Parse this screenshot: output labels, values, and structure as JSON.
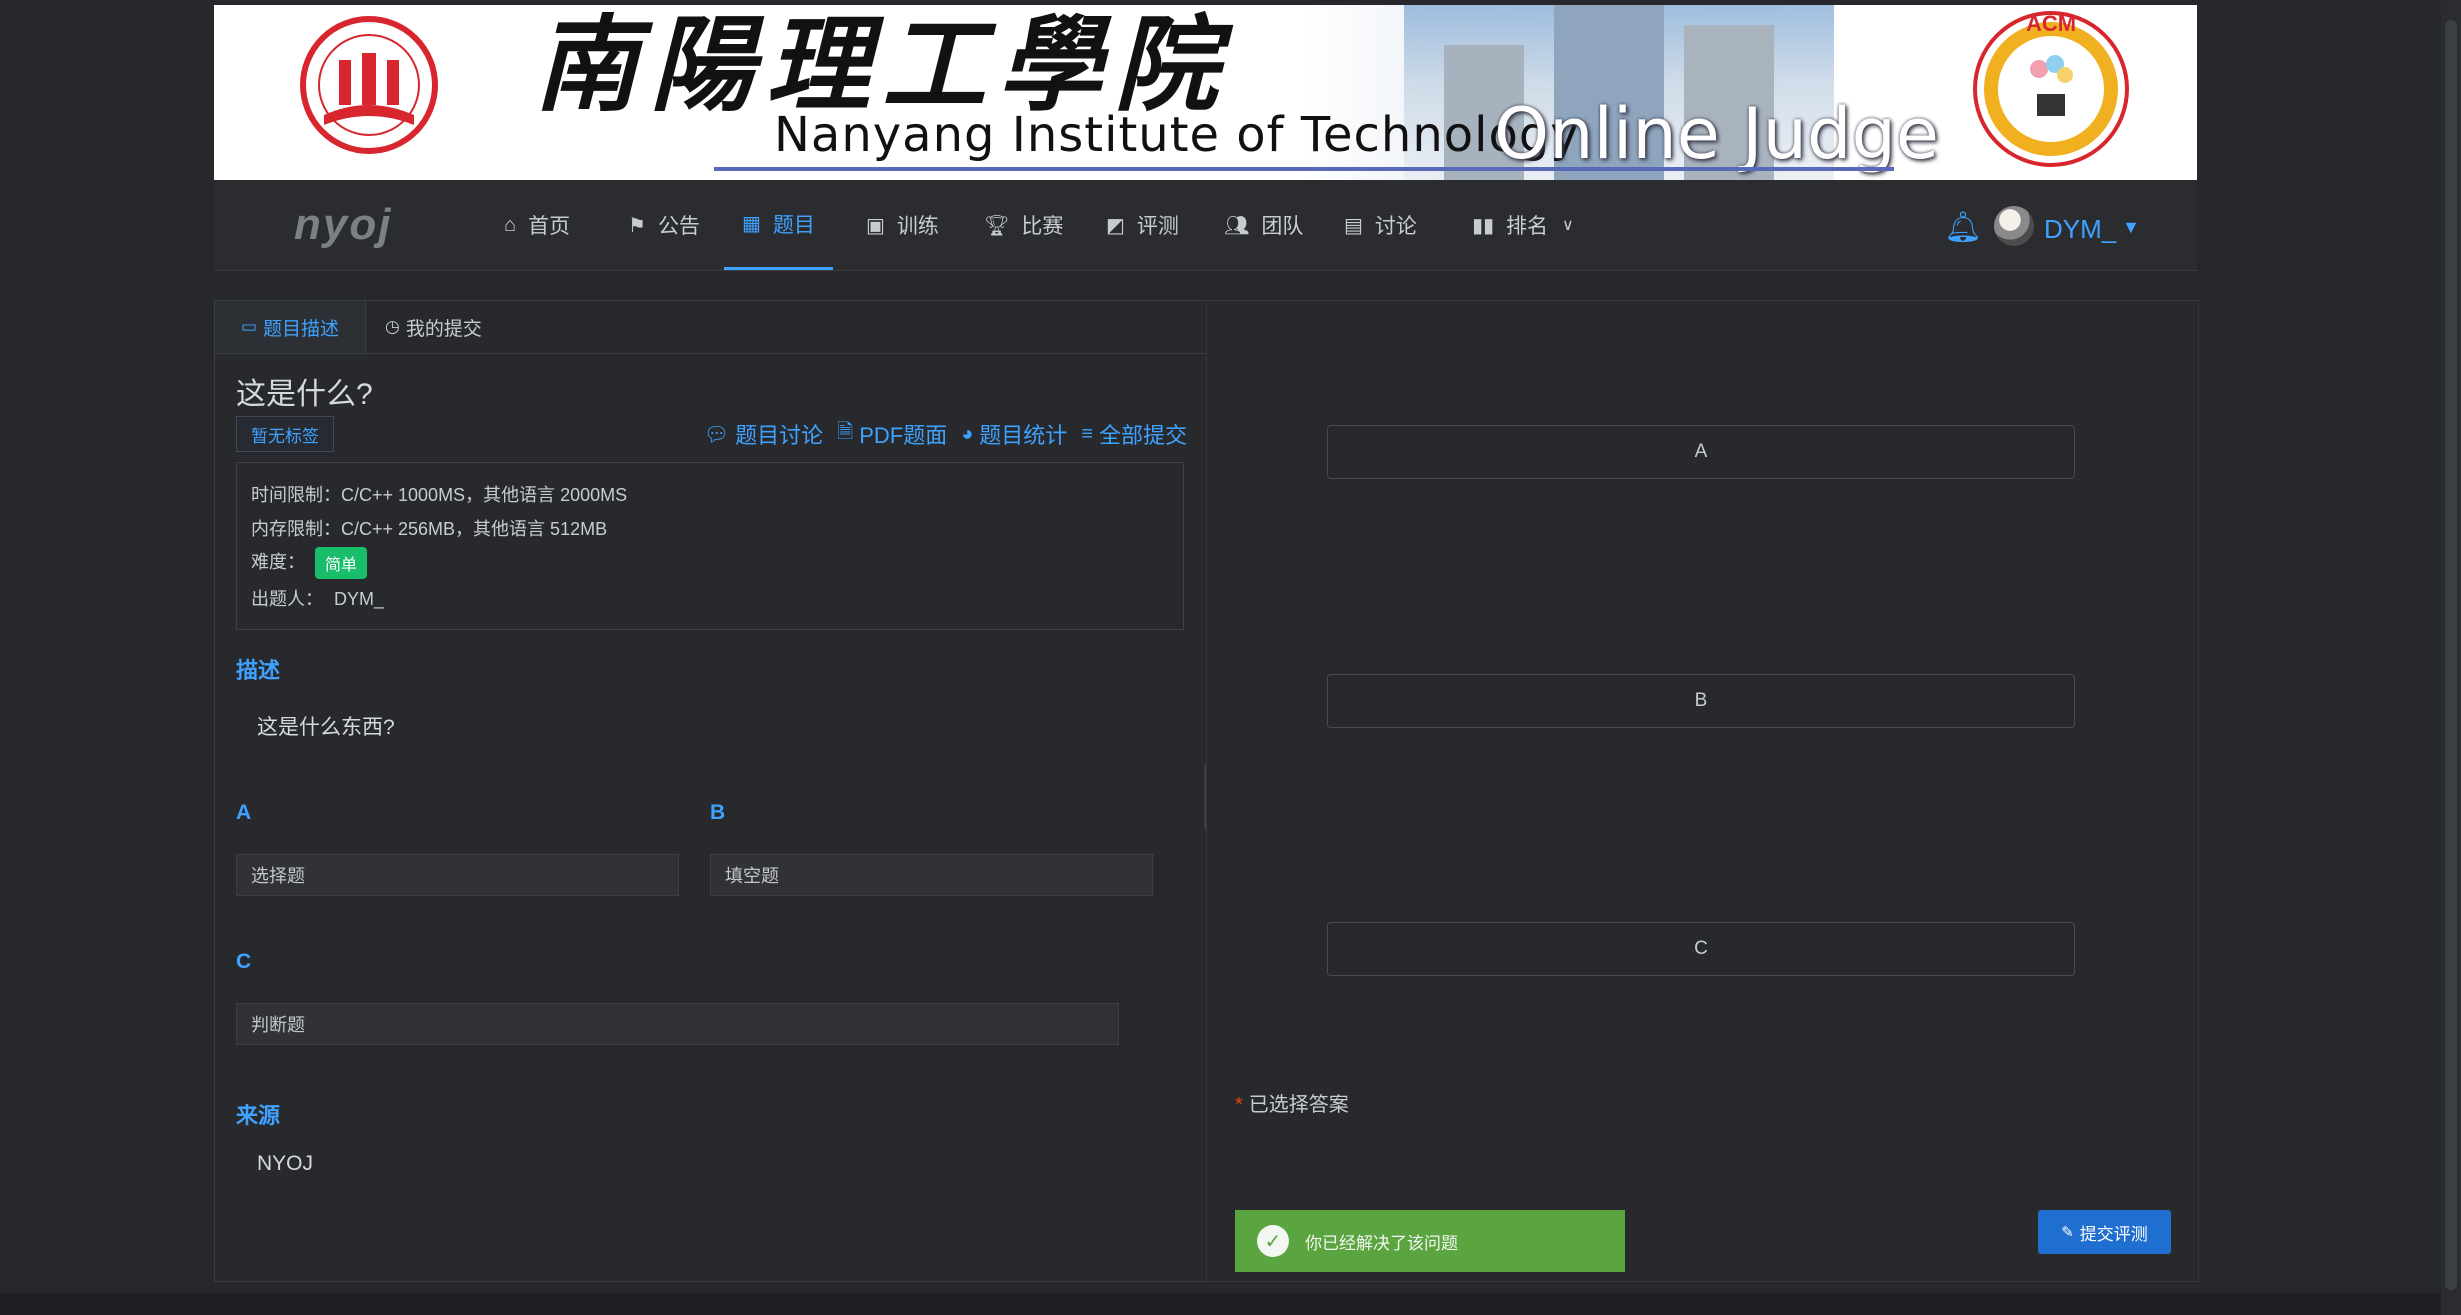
{
  "banner": {
    "cn_title": "南陽理工學院",
    "en_title": "Nanyang Institute of Technology",
    "oj_title": "Online Judge",
    "acm_text": "ACM"
  },
  "navbar": {
    "brand": "nyoj",
    "items": [
      {
        "label": "首页",
        "icon": "home-icon"
      },
      {
        "label": "公告",
        "icon": "flag-icon"
      },
      {
        "label": "题目",
        "icon": "grid-icon",
        "active": true
      },
      {
        "label": "训练",
        "icon": "clipboard-icon"
      },
      {
        "label": "比赛",
        "icon": "trophy-icon"
      },
      {
        "label": "评测",
        "icon": "chart-icon"
      },
      {
        "label": "团队",
        "icon": "team-icon"
      },
      {
        "label": "讨论",
        "icon": "chat-icon"
      },
      {
        "label": "排名",
        "icon": "bar-chart-icon"
      }
    ],
    "username": "DYM_"
  },
  "left": {
    "tabs": [
      {
        "label": "题目描述",
        "active": true
      },
      {
        "label": "我的提交"
      }
    ],
    "title": "这是什么?",
    "tag": "暂无标签",
    "links": {
      "discuss": "题目讨论",
      "pdf": "PDF题面",
      "stats": "题目统计",
      "all_submissions": "全部提交"
    },
    "info": {
      "time_limit": "时间限制：C/C++ 1000MS，其他语言 2000MS",
      "memory_limit": "内存限制：C/C++ 256MB，其他语言 512MB",
      "difficulty_label": "难度：",
      "difficulty": "简单",
      "author_label": "出题人：",
      "author": "DYM_"
    },
    "description_label": "描述",
    "description": "这是什么东西?",
    "options": [
      {
        "key": "A",
        "text": "选择题"
      },
      {
        "key": "B",
        "text": "填空题"
      },
      {
        "key": "C",
        "text": "判断题"
      }
    ],
    "source_label": "来源",
    "source": "NYOJ"
  },
  "right": {
    "choices": [
      "A",
      "B",
      "C"
    ],
    "selected_label": "已选择答案",
    "solved_message": "你已经解决了该问题",
    "submit_label": "提交评测"
  },
  "colors": {
    "accent": "#3fa2ff",
    "success": "#5aa540",
    "difficulty": "#19be6b",
    "submit": "#1f6fd0"
  }
}
